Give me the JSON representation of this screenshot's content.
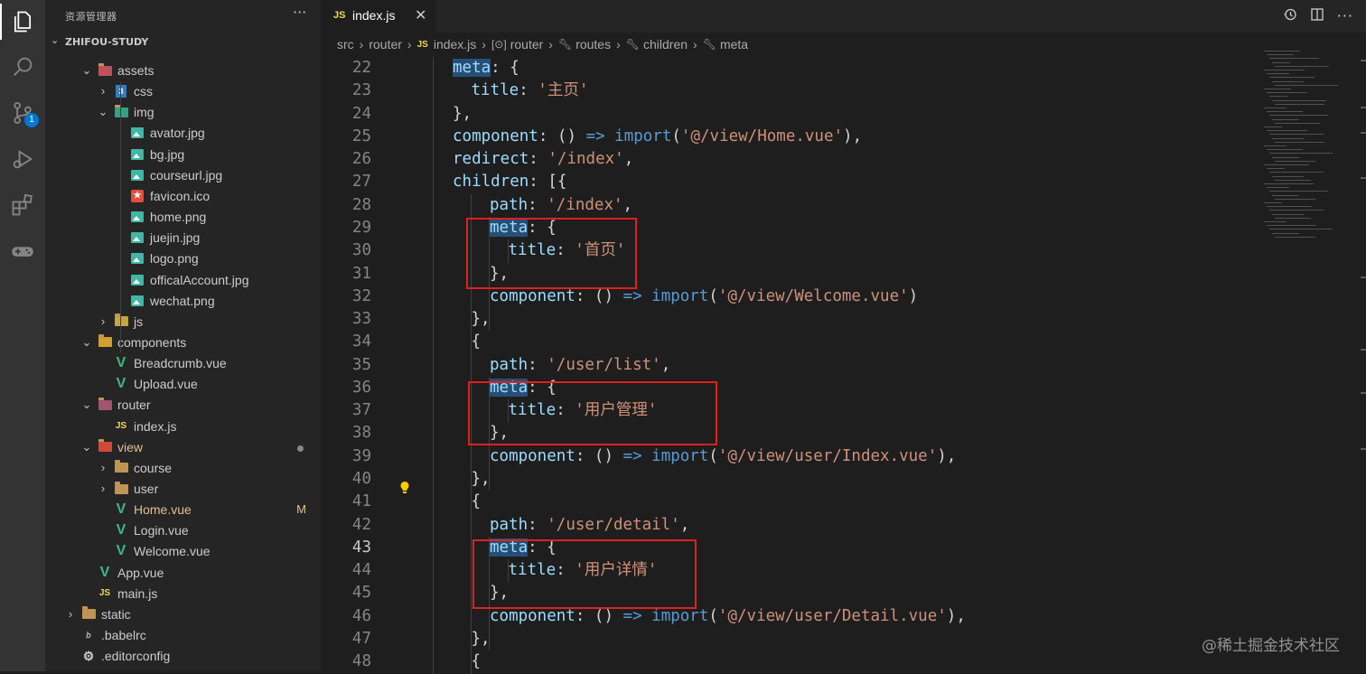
{
  "sidebar": {
    "title": "资源管理器",
    "more": "···",
    "workspace": "ZHIFOU-STUDY",
    "items": [
      {
        "name": "assets",
        "indent": 1,
        "twisty": "⌄",
        "icon": "folder-assets-icon"
      },
      {
        "name": "css",
        "indent": 2,
        "twisty": "›",
        "icon": "folder-css-icon"
      },
      {
        "name": "img",
        "indent": 2,
        "twisty": "⌄",
        "icon": "folder-images-icon"
      },
      {
        "name": "avator.jpg",
        "indent": 3,
        "icon": "image-file-icon"
      },
      {
        "name": "bg.jpg",
        "indent": 3,
        "icon": "image-file-icon"
      },
      {
        "name": "courseurl.jpg",
        "indent": 3,
        "icon": "image-file-icon"
      },
      {
        "name": "favicon.ico",
        "indent": 3,
        "icon": "favicon-file-icon"
      },
      {
        "name": "home.png",
        "indent": 3,
        "icon": "image-file-icon"
      },
      {
        "name": "juejin.jpg",
        "indent": 3,
        "icon": "image-file-icon"
      },
      {
        "name": "logo.png",
        "indent": 3,
        "icon": "image-file-icon"
      },
      {
        "name": "officalAccount.jpg",
        "indent": 3,
        "icon": "image-file-icon"
      },
      {
        "name": "wechat.png",
        "indent": 3,
        "icon": "image-file-icon"
      },
      {
        "name": "js",
        "indent": 2,
        "twisty": "›",
        "icon": "folder-js-icon"
      },
      {
        "name": "components",
        "indent": 1,
        "twisty": "⌄",
        "icon": "folder-components-icon"
      },
      {
        "name": "Breadcrumb.vue",
        "indent": 2,
        "icon": "vue-file-icon"
      },
      {
        "name": "Upload.vue",
        "indent": 2,
        "icon": "vue-file-icon"
      },
      {
        "name": "router",
        "indent": 1,
        "twisty": "⌄",
        "icon": "folder-router-icon"
      },
      {
        "name": "index.js",
        "indent": 2,
        "icon": "js-file-icon"
      },
      {
        "name": "view",
        "indent": 1,
        "twisty": "⌄",
        "icon": "folder-view-icon",
        "modified_dot": true
      },
      {
        "name": "course",
        "indent": 2,
        "twisty": "›",
        "icon": "folder-icon"
      },
      {
        "name": "user",
        "indent": 2,
        "twisty": "›",
        "icon": "folder-icon"
      },
      {
        "name": "Home.vue",
        "indent": 2,
        "icon": "vue-file-icon",
        "status": "M"
      },
      {
        "name": "Login.vue",
        "indent": 2,
        "icon": "vue-file-icon"
      },
      {
        "name": "Welcome.vue",
        "indent": 2,
        "icon": "vue-file-icon"
      },
      {
        "name": "App.vue",
        "indent": 1,
        "icon": "vue-file-icon"
      },
      {
        "name": "main.js",
        "indent": 1,
        "icon": "js-file-icon"
      },
      {
        "name": "static",
        "indent": 0,
        "twisty": "›",
        "icon": "folder-icon"
      },
      {
        "name": ".babelrc",
        "indent": 0,
        "icon": "babel-file-icon"
      },
      {
        "name": ".editorconfig",
        "indent": 0,
        "icon": "editorconfig-file-icon"
      }
    ]
  },
  "activity_bar": {
    "scm_badge": "1"
  },
  "tab": {
    "lang": "JS",
    "filename": "index.js",
    "close": "✕"
  },
  "breadcrumb": {
    "src": "src",
    "router": "router",
    "file": "index.js",
    "router_obj": "router",
    "routes": "routes",
    "children": "children",
    "meta": "meta"
  },
  "code": {
    "current_line": 43,
    "lines": [
      {
        "n": "22",
        "text": "meta: {"
      },
      {
        "n": "23",
        "text": "title: '主页'"
      },
      {
        "n": "24",
        "text": "},"
      },
      {
        "n": "25",
        "text": "component: () => import('@/view/Home.vue'),"
      },
      {
        "n": "26",
        "text": "redirect: '/index',"
      },
      {
        "n": "27",
        "text": "children: [{"
      },
      {
        "n": "28",
        "text": "path: '/index',"
      },
      {
        "n": "29",
        "text": "meta: {"
      },
      {
        "n": "30",
        "text": "title: '首页'"
      },
      {
        "n": "31",
        "text": "},"
      },
      {
        "n": "32",
        "text": "component: () => import('@/view/Welcome.vue')"
      },
      {
        "n": "33",
        "text": "},"
      },
      {
        "n": "34",
        "text": "{"
      },
      {
        "n": "35",
        "text": "path: '/user/list',"
      },
      {
        "n": "36",
        "text": "meta: {"
      },
      {
        "n": "37",
        "text": "title: '用户管理'"
      },
      {
        "n": "38",
        "text": "},"
      },
      {
        "n": "39",
        "text": "component: () => import('@/view/user/Index.vue'),"
      },
      {
        "n": "40",
        "text": "},"
      },
      {
        "n": "41",
        "text": "{"
      },
      {
        "n": "42",
        "text": "path: '/user/detail',"
      },
      {
        "n": "43",
        "text": "meta: {"
      },
      {
        "n": "44",
        "text": "title: '用户详情'"
      },
      {
        "n": "45",
        "text": "},"
      },
      {
        "n": "46",
        "text": "component: () => import('@/view/user/Detail.vue'),"
      },
      {
        "n": "47",
        "text": "},"
      },
      {
        "n": "48",
        "text": "{"
      }
    ]
  },
  "watermark": "@稀土掘金技术社区",
  "colors": {
    "annotation_box": "#e0201e",
    "keyword": "#9cdcfe",
    "string": "#ce9178"
  }
}
